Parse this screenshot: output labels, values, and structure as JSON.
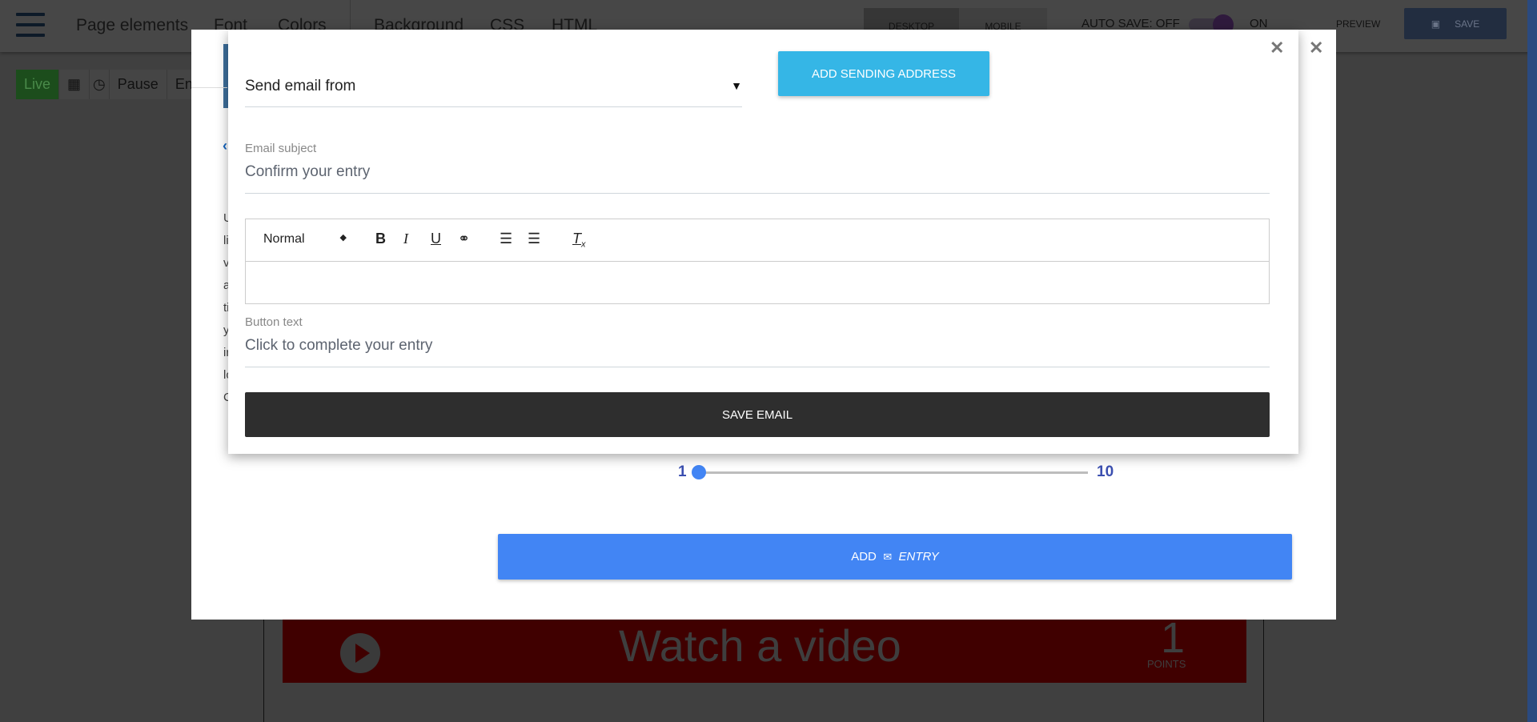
{
  "topbar": {
    "nav": [
      "Page elements",
      "Font",
      "Colors",
      "Background",
      "CSS",
      "HTML"
    ],
    "desktop": "DESKTOP",
    "mobile": "MOBILE",
    "autosave": "AUTO SAVE: OFF",
    "autosave_on": "ON",
    "preview": "PREVIEW",
    "save": "SAVE"
  },
  "subbar": {
    "live": "Live",
    "pause": "Pause",
    "end": "En"
  },
  "background_card": {
    "title": "Watch a video",
    "points": "1",
    "points_label": "POINTS",
    "left_text": [
      "U",
      "li",
      "v",
      "a",
      "ti",
      "y",
      "ir",
      "lo",
      "C"
    ]
  },
  "email_modal": {
    "send_from": "Send email from",
    "add_sending_address": "ADD SENDING ADDRESS",
    "subject_label": "Email subject",
    "subject_value": "Confirm your entry",
    "editor": {
      "format": "Normal",
      "tools": [
        "bold",
        "italic",
        "underline",
        "link",
        "ordered-list",
        "bullet-list",
        "clear-format"
      ]
    },
    "button_text_label": "Button text",
    "button_text_value": "Click to complete your entry",
    "save_email": "SAVE EMAIL"
  },
  "outer_modal": {
    "slider_min": "1",
    "slider_max": "10",
    "slider_value": 1,
    "add_entry": "ADD",
    "add_entry_icon": "✉",
    "add_entry_suffix": "ENTRY"
  },
  "colors": {
    "accent_blue": "#4285f4",
    "sending_btn": "#35b6e6",
    "save_email": "#2e2e2e"
  }
}
